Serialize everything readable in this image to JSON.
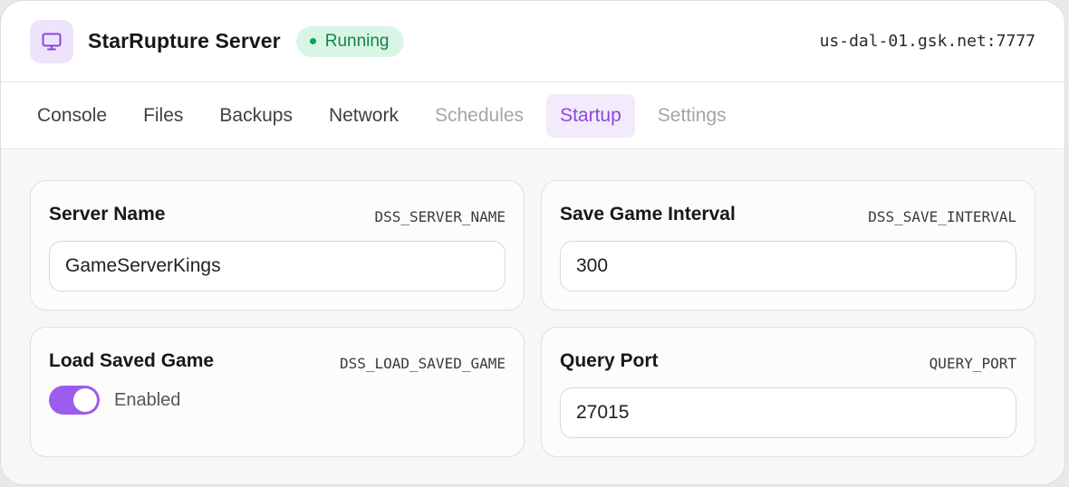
{
  "server": {
    "icon": "monitor-icon",
    "name": "StarRupture Server",
    "status": "Running",
    "status_color": "#118447",
    "address": "us-dal-01.gsk.net:7777"
  },
  "tabs": [
    {
      "label": "Console",
      "state": "normal"
    },
    {
      "label": "Files",
      "state": "normal"
    },
    {
      "label": "Backups",
      "state": "normal"
    },
    {
      "label": "Network",
      "state": "normal"
    },
    {
      "label": "Schedules",
      "state": "disabled"
    },
    {
      "label": "Startup",
      "state": "active"
    },
    {
      "label": "Settings",
      "state": "disabled"
    }
  ],
  "accent_color": "#9146e2",
  "variables": {
    "server_name": {
      "label": "Server Name",
      "var": "DSS_SERVER_NAME",
      "value": "GameServerKings"
    },
    "save_interval": {
      "label": "Save Game Interval",
      "var": "DSS_SAVE_INTERVAL",
      "value": "300"
    },
    "load_saved": {
      "label": "Load Saved Game",
      "var": "DSS_LOAD_SAVED_GAME",
      "enabled": true,
      "state_label": "Enabled"
    },
    "query_port": {
      "label": "Query Port",
      "var": "QUERY_PORT",
      "value": "27015"
    }
  }
}
